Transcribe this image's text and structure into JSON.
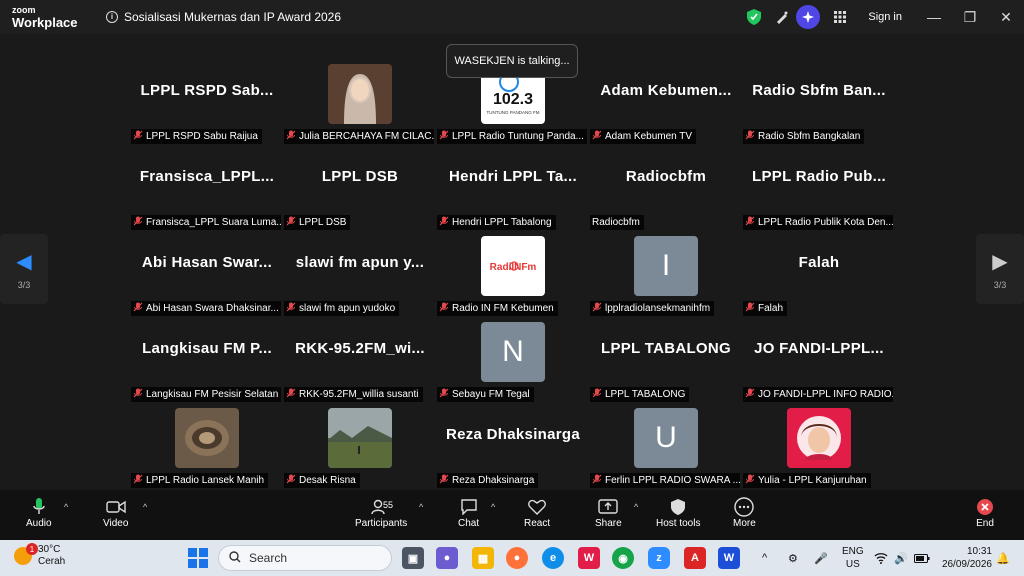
{
  "app": {
    "brand_small": "zoom",
    "brand_large": "Workplace",
    "meeting_title": "Sosialisasi Mukernas dan IP Award 2026",
    "sign_in": "Sign in"
  },
  "talking_banner": "WASEKJEN is talking...",
  "page_indicator": {
    "left": "3/3",
    "right": "3/3"
  },
  "tiles": [
    {
      "kind": "name",
      "big": "LPPL RSPD Sab...",
      "label": "LPPL RSPD Sabu Raijua",
      "muted": true
    },
    {
      "kind": "photo",
      "big": "",
      "label": "Julia BERCAHAYA FM CILAC...",
      "muted": true,
      "photo": "woman-hijab"
    },
    {
      "kind": "photo",
      "big": "",
      "label": "LPPL Radio Tuntung Panda...",
      "muted": true,
      "photo": "logo-1023"
    },
    {
      "kind": "name",
      "big": "Adam Kebumen...",
      "label": "Adam Kebumen TV",
      "muted": true
    },
    {
      "kind": "name",
      "big": "Radio Sbfm Ban...",
      "label": "Radio Sbfm Bangkalan",
      "muted": true
    },
    {
      "kind": "name",
      "big": "Fransisca_LPPL...",
      "label": "Fransisca_LPPL Suara Luma...",
      "muted": true
    },
    {
      "kind": "name",
      "big": "LPPL DSB",
      "label": "LPPL DSB",
      "muted": true
    },
    {
      "kind": "name",
      "big": "Hendri LPPL Ta...",
      "label": "Hendri LPPL Tabalong",
      "muted": true
    },
    {
      "kind": "name",
      "big": "Radiocbfm",
      "label": "Radiocbfm",
      "muted": false
    },
    {
      "kind": "name",
      "big": "LPPL Radio Pub...",
      "label": "LPPL Radio Publik Kota Den...",
      "muted": true
    },
    {
      "kind": "name",
      "big": "Abi Hasan Swar...",
      "label": "Abi Hasan Swara Dhaksinar...",
      "muted": true
    },
    {
      "kind": "name",
      "big": "slawi fm apun y...",
      "label": "slawi fm apun yudoko",
      "muted": true
    },
    {
      "kind": "photo",
      "big": "",
      "label": "Radio IN FM Kebumen",
      "muted": true,
      "photo": "logo-infm"
    },
    {
      "kind": "letter",
      "big": "I",
      "label": "lpplradiolansekmanihfm",
      "muted": true
    },
    {
      "kind": "name",
      "big": "Falah",
      "label": "Falah",
      "muted": true
    },
    {
      "kind": "name",
      "big": "Langkisau FM P...",
      "label": "Langkisau FM Pesisir Selatan",
      "muted": true
    },
    {
      "kind": "name",
      "big": "RKK-95.2FM_wi...",
      "label": "RKK-95.2FM_willia susanti",
      "muted": true
    },
    {
      "kind": "letter",
      "big": "N",
      "label": "Sebayu FM Tegal",
      "muted": true
    },
    {
      "kind": "name",
      "big": "LPPL TABALONG",
      "label": "LPPL TABALONG",
      "muted": true
    },
    {
      "kind": "name",
      "big": "JO FANDI-LPPL...",
      "label": "JO FANDI-LPPL INFO RADIO...",
      "muted": true
    },
    {
      "kind": "photo",
      "big": "",
      "label": "LPPL Radio Lansek Manih",
      "muted": true,
      "photo": "drum"
    },
    {
      "kind": "photo",
      "big": "",
      "label": "Desak Risna",
      "muted": true,
      "photo": "landscape"
    },
    {
      "kind": "name",
      "big": "Reza Dhaksinarga",
      "label": "Reza Dhaksinarga",
      "muted": true
    },
    {
      "kind": "letter",
      "big": "U",
      "label": "Ferlin LPPL RADIO SWARA ...",
      "muted": true
    },
    {
      "kind": "photo",
      "big": "",
      "label": "Yulia  - LPPL Kanjuruhan",
      "muted": true,
      "photo": "woman-red"
    }
  ],
  "photo_text": {
    "logo_1023": "102.3",
    "logo_1023_sub": "TUNTUNG PANDANG FM",
    "logo_infm": "RadiINFm"
  },
  "toolbar": {
    "audio": "Audio",
    "video": "Video",
    "participants": "Participants",
    "participants_count": "55",
    "chat": "Chat",
    "react": "React",
    "share": "Share",
    "host_tools": "Host tools",
    "more": "More",
    "end": "End"
  },
  "taskbar": {
    "temp": "30°C",
    "weather": "Cerah",
    "weather_badge": "1",
    "search_placeholder": "Search",
    "lang_top": "ENG",
    "lang_bottom": "US",
    "time": "10:31",
    "date": "26/09/2026"
  },
  "colors": {
    "accent": "#2d8cff",
    "muted_mic": "#e5484d",
    "end": "#e5484d",
    "tile_letter_bg": "#7b8a96"
  }
}
